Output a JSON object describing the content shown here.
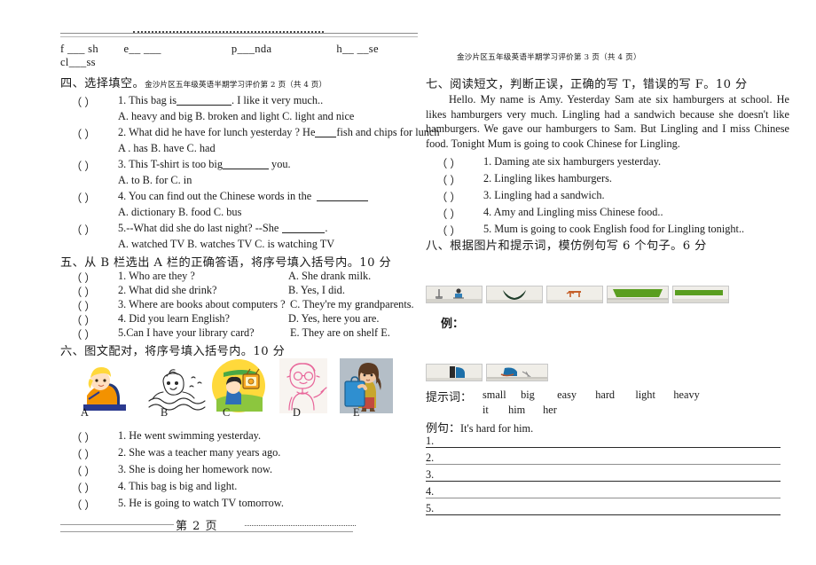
{
  "document": {
    "header_note_right": "金沙片区五年级英语半期学习评价第 3 页（共 4 页）",
    "footer_page": "第 2 页"
  },
  "top_blanks": {
    "items": [
      "f ___ sh",
      "e__  ___",
      "p___nda",
      "h__  __se",
      "cl___ss"
    ]
  },
  "section4": {
    "heading": "四、选择填空。",
    "heading_note": "金沙片区五年级英语半期学习评价第 2 页（共 4 页）",
    "questions": [
      {
        "paren": "（       ）",
        "stem_a": "1. This bag is",
        "stem_b": ". I like it very much..",
        "options": "A. heavy and big            B. broken and light        C. light and nice"
      },
      {
        "paren": "（       ）",
        "stem_a": "2. What did he have for lunch yesterday ? He",
        "stem_b": "fish and chips for lunch",
        "options": "A . has                B. have              C. had"
      },
      {
        "paren": "（       ）",
        "stem_a": "3. This T-shirt is too big",
        "stem_b": " you.",
        "options": "A. to                  B. for               C. in"
      },
      {
        "paren": "（       ）",
        "stem_a": "4. You can find out the Chinese words in the",
        "stem_b": "",
        "options": "A. dictionary        B. food            C. bus"
      },
      {
        "paren": "（       ）",
        "stem_a": "5.--What did she do last night?     --She",
        "stem_b": ".",
        "options": "A. watched TV      B. watches TV     C. is watching TV"
      }
    ]
  },
  "section5": {
    "heading": "五、从 B 栏选出 A 栏的正确答语，将序号填入括号内。10 分",
    "rows": [
      {
        "paren": "（       ）",
        "left": "1. Who are they ?",
        "right": "A. She drank milk."
      },
      {
        "paren": "（       ）",
        "left": "2. What did she drink?",
        "right": "B. Yes, I did."
      },
      {
        "paren": "（       ）",
        "left": "3. Where are books about computers ?",
        "right": "C. They're my grandparents."
      },
      {
        "paren": "（       ）",
        "left": "4. Did you learn English?",
        "right": "D. Yes, here you are."
      },
      {
        "paren": "（       ）",
        "left": "5.Can I have your library card?",
        "right": "E. They are on shelf E."
      }
    ]
  },
  "section6": {
    "heading": "六、图文配对，将序号填入括号内。10 分",
    "picture_labels": [
      "A",
      "B",
      "C",
      "D",
      "E"
    ],
    "picture_names": [
      "girl-doing-homework",
      "boy-swimming-sketch",
      "boy-watching-tv",
      "teacher-pink-sketch",
      "girl-with-big-suitcase"
    ],
    "rows": [
      {
        "paren": "（       ）",
        "text": "1. He went swimming yesterday."
      },
      {
        "paren": "（       ）",
        "text": "2. She was a teacher many years ago."
      },
      {
        "paren": "（       ）",
        "text": "3. She is doing her homework now."
      },
      {
        "paren": "（       ）",
        "text": "4. This bag is big and light."
      },
      {
        "paren": "（       ）",
        "text": "5. He is going to watch TV tomorrow."
      }
    ]
  },
  "section7": {
    "heading": "七、阅读短文，判断正误，正确的写 T，错误的写 F。10 分",
    "passage": "Hello. My name is Amy. Yesterday Sam ate six hamburgers at school. He likes hamburgers very much. Lingling had a sandwich because she doesn't like hamburgers. We gave our hamburgers to Sam. But Lingling and I miss Chinese food. Tonight Mum is going to cook Chinese for Lingling.",
    "rows": [
      {
        "paren": "（       ）",
        "text": "1. Daming ate six hamburgers yesterday."
      },
      {
        "paren": "（       ）",
        "text": "2. Lingling likes hamburgers."
      },
      {
        "paren": "（       ）",
        "text": "3. Lingling had a sandwich."
      },
      {
        "paren": "（       ）",
        "text": "4. Amy and Lingling miss Chinese food.."
      },
      {
        "paren": "（       ）",
        "text": "5. Mum is going to cook English food for Lingling tonight.."
      }
    ]
  },
  "section8": {
    "heading": "八、根据图片和提示词，模仿例句写 6 个句子。6 分",
    "example_label": "例：",
    "hint_label": "提示词：",
    "hint_words_row1": [
      "small",
      "big",
      "easy",
      "hard",
      "light",
      "heavy"
    ],
    "hint_words_row2": [
      "it",
      "him",
      "her"
    ],
    "example_sentence_label": "例句：",
    "example_sentence": "It's hard for him.",
    "strip_names": [
      "photo-strip-broom-child",
      "photo-strip-dark-shape",
      "photo-strip-orange-chair",
      "photo-strip-green-board",
      "photo-strip-green-bar",
      "photo-strip-blue-legs",
      "photo-strip-blue-person"
    ],
    "answer_numbers": [
      "1.",
      "2.",
      "3.",
      "4.",
      "5."
    ]
  },
  "colors": {
    "text": "#1a1a1a",
    "rule": "#8d8d8d",
    "line_dark": "#2a2a2a",
    "line_light": "#8f8f8f"
  }
}
